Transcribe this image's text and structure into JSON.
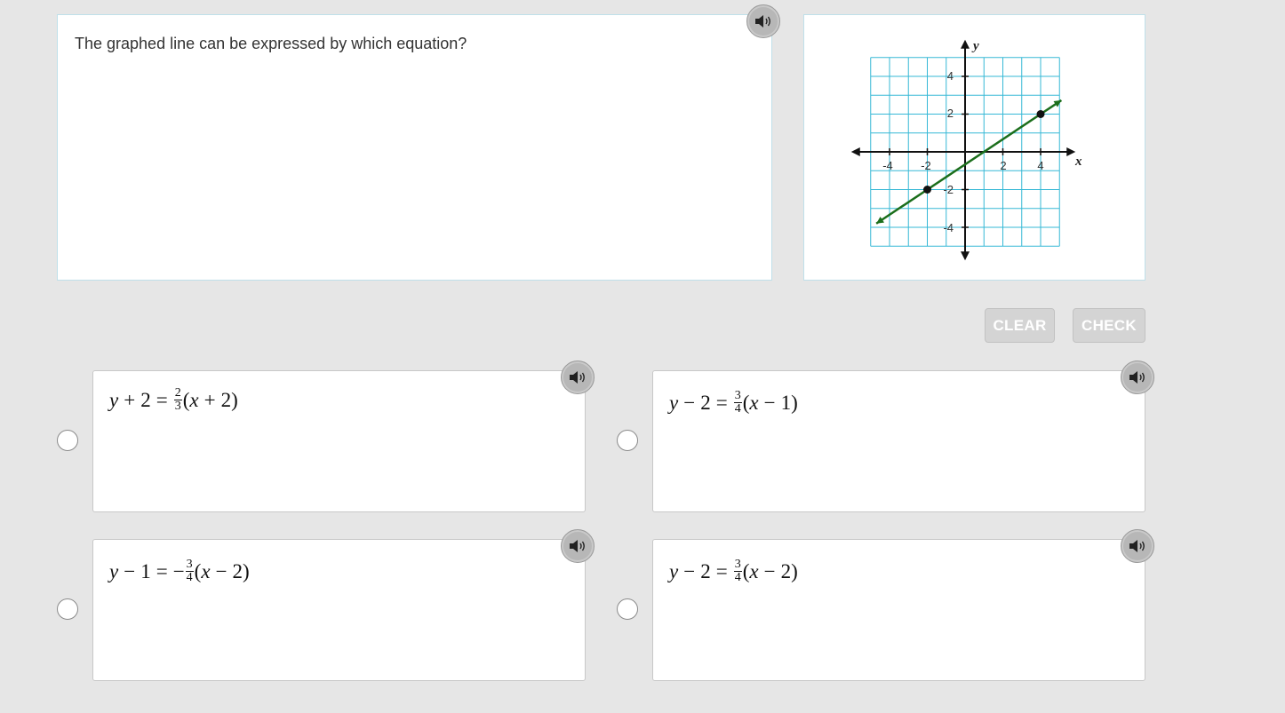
{
  "question": {
    "text": "The graphed line can be expressed by which equation?"
  },
  "graph": {
    "x_axis_label": "x",
    "y_axis_label": "y",
    "x_tick_labels": [
      "-4",
      "-2",
      "2",
      "4"
    ],
    "y_tick_labels": [
      "4",
      "2",
      "-2",
      "-4"
    ],
    "grid_color": "#36b8d6",
    "line_color": "#1b6e1b",
    "points": [
      {
        "x": -2,
        "y": -2
      },
      {
        "x": 4,
        "y": 2
      }
    ],
    "x_range": [
      -5,
      5
    ],
    "y_range": [
      -5,
      5
    ]
  },
  "buttons": {
    "clear": "CLEAR",
    "check": "CHECK"
  },
  "choices": [
    {
      "lhs_var": "y",
      "lhs_op": "+",
      "lhs_const": "2",
      "sign": "",
      "num": "2",
      "den": "3",
      "x_var": "x",
      "x_op": "+",
      "x_const": "2"
    },
    {
      "lhs_var": "y",
      "lhs_op": "−",
      "lhs_const": "2",
      "sign": "",
      "num": "3",
      "den": "4",
      "x_var": "x",
      "x_op": "−",
      "x_const": "1"
    },
    {
      "lhs_var": "y",
      "lhs_op": "−",
      "lhs_const": "1",
      "sign": "−",
      "num": "3",
      "den": "4",
      "x_var": "x",
      "x_op": "−",
      "x_const": "2"
    },
    {
      "lhs_var": "y",
      "lhs_op": "−",
      "lhs_const": "2",
      "sign": "",
      "num": "3",
      "den": "4",
      "x_var": "x",
      "x_op": "−",
      "x_const": "2"
    }
  ],
  "icons": {
    "speaker": "speaker-icon",
    "radio": "radio-button"
  }
}
